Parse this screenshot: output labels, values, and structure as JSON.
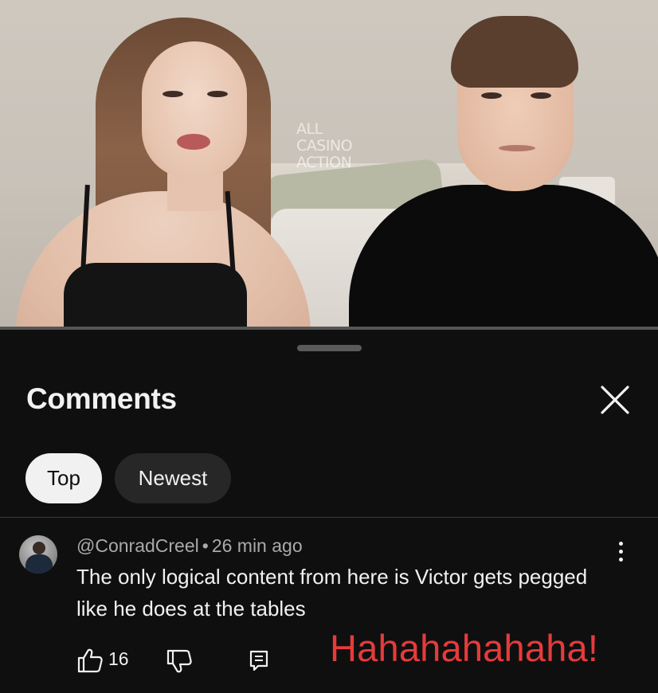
{
  "video": {
    "watermark_lines": [
      "ALL",
      "CASINO",
      "ACTION"
    ]
  },
  "comments_panel": {
    "title": "Comments",
    "close_icon": "close-icon",
    "sort_chips": [
      {
        "label": "Top",
        "selected": true
      },
      {
        "label": "Newest",
        "selected": false
      }
    ]
  },
  "comment": {
    "author": "@ConradCreel",
    "separator": "•",
    "time": "26 min ago",
    "text": "The only logical content from here is Victor gets pegged like he does at the tables",
    "like_count": "16",
    "icons": [
      "thumbs-up-icon",
      "thumbs-down-icon",
      "reply-icon",
      "more-options-icon"
    ]
  },
  "overlay": {
    "text": "Hahahahahaha!",
    "color": "#e53b3b"
  },
  "colors": {
    "background": "#0f0f0f",
    "chip_selected": "#f1f1f1",
    "chip_unselected": "#272727",
    "secondary_text": "#aaaaaa"
  }
}
